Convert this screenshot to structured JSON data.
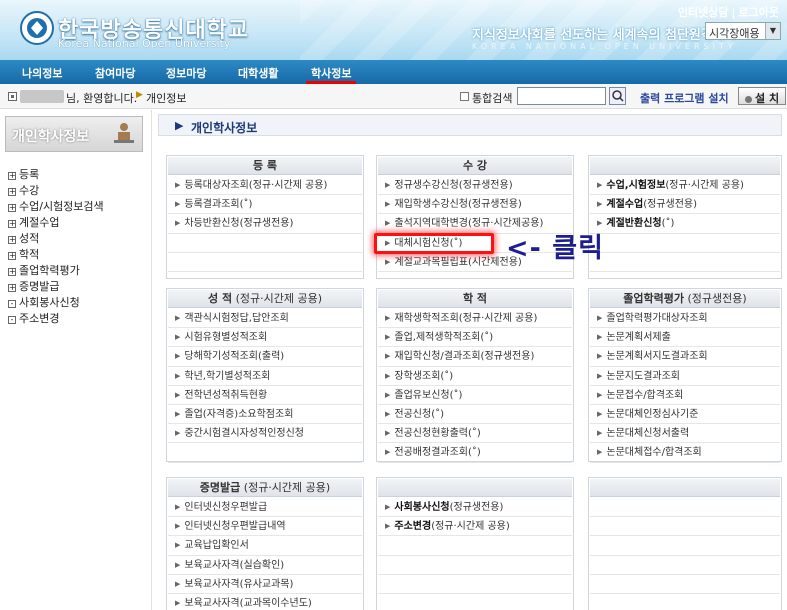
{
  "header": {
    "logo_kr": "한국방송통신대학교",
    "logo_en": "Korea National Open University",
    "top_links": [
      "인터넷상담",
      "로그아웃"
    ],
    "slogan": "지식정보사회를 선도하는 세계속의 첨단원격대학",
    "slogan_en": "KOREA NATIONAL OPEN UNIVERSITY",
    "shortcut_select": "시각장애용"
  },
  "nav": {
    "items": [
      "나의정보",
      "참여마당",
      "정보마당",
      "대학생활",
      "학사정보"
    ],
    "active": "학사정보"
  },
  "welcome": {
    "greeting": "님, 환영합니다.",
    "breadcrumb": "개인정보",
    "search_label": "통합검색",
    "search_placeholder": "",
    "print_link": "출력 프로그램 설치",
    "install_button": "설 치"
  },
  "sidebar": {
    "title": "개인학사정보",
    "items": [
      {
        "label": "등록",
        "mark": "+"
      },
      {
        "label": "수강",
        "mark": "+"
      },
      {
        "label": "수업/시험정보검색",
        "mark": "+"
      },
      {
        "label": "계절수업",
        "mark": "+"
      },
      {
        "label": "성적",
        "mark": "+"
      },
      {
        "label": "학적",
        "mark": "+"
      },
      {
        "label": "졸업학력평가",
        "mark": "+"
      },
      {
        "label": "증명발급",
        "mark": "+"
      },
      {
        "label": "사회봉사신청",
        "mark": "-"
      },
      {
        "label": "주소변경",
        "mark": "-"
      }
    ]
  },
  "main": {
    "title": "개인학사정보",
    "panels": {
      "register": {
        "header_bold": "등   록",
        "header_rest": "",
        "rows": [
          "등록대상자조회(정규·시간제 공용)",
          "등록결과조회(˚)",
          "차등반환신청(정규생전용)",
          "",
          "",
          "",
          ""
        ]
      },
      "course": {
        "header_bold": "수   강",
        "header_rest": "",
        "rows": [
          "정규생수강신청(정규생전용)",
          "재입학생수강신청(정규생전용)",
          "출석지역대학변경(정규·시간제공용)",
          "대체시험신청(˚)",
          "계절교과목필립표(시간제전용)",
          "",
          ""
        ]
      },
      "class_info": {
        "header_bold": "",
        "header_rest": "",
        "rows": [
          {
            "bold": "수업,시험정보",
            "rest": "(정규·시간제 공용)"
          },
          {
            "bold": "계절수업",
            "rest": "(정규생전용)"
          },
          {
            "bold": "계절반환신청",
            "rest": "(˚)"
          },
          {
            "bold": "",
            "rest": ""
          },
          {
            "bold": "",
            "rest": ""
          },
          {
            "bold": "",
            "rest": ""
          },
          {
            "bold": "",
            "rest": ""
          }
        ]
      },
      "grades": {
        "header_bold": "성   적",
        "header_rest": " (정규·시간제 공용)",
        "rows": [
          "객관식시험정답,답안조회",
          "시험유형별성적조회",
          "당해학기성적조회(출력)",
          "학년,학기별성적조회",
          "전학년성적취득현황",
          "졸업(자격증)소요학점조회",
          "중간시험결시자성적인정신청",
          ""
        ]
      },
      "records": {
        "header_bold": "학   적",
        "header_rest": "",
        "rows": [
          "재학생학적조회(정규·시간제 공용)",
          "졸업,제적생학적조회(˚)",
          "재입학신청/결과조회(정규생전용)",
          "장학생조회(˚)",
          "졸업유보신청(˚)",
          "전공신청(˚)",
          "전공신청현황출력(˚)",
          "전공배정결과조회(˚)"
        ]
      },
      "graduation": {
        "header_bold": "졸업학력평가",
        "header_rest": " (정규생전용)",
        "rows": [
          "졸업학력평가대상자조회",
          "논문계획서제출",
          "논문계획서지도결과조회",
          "논문지도결과조회",
          "논문접수/합격조회",
          "논문대체인정심사기준",
          "논문대체신청서출력",
          "논문대체접수/합격조회"
        ]
      },
      "certificate": {
        "header_bold": "증명발급",
        "header_rest": " (정규·시간제 공용)",
        "rows": [
          "인터넷신청우편발급",
          "인터넷신청우편발급내역",
          "교육납입확인서",
          "보육교사자격(실습확인)",
          "보육교사자격(유사교과목)",
          "보육교사자격(교과목이수년도)"
        ]
      },
      "service": {
        "rows": [
          {
            "bold": "사회봉사신청",
            "rest": "(정규생전용)"
          },
          {
            "bold": "주소변경",
            "rest": "(정규·시간제 공용)"
          },
          {
            "bold": "",
            "rest": ""
          },
          {
            "bold": "",
            "rest": ""
          },
          {
            "bold": "",
            "rest": ""
          },
          {
            "bold": "",
            "rest": ""
          }
        ]
      }
    }
  },
  "annotation": {
    "click_note": "<- 클릭"
  }
}
